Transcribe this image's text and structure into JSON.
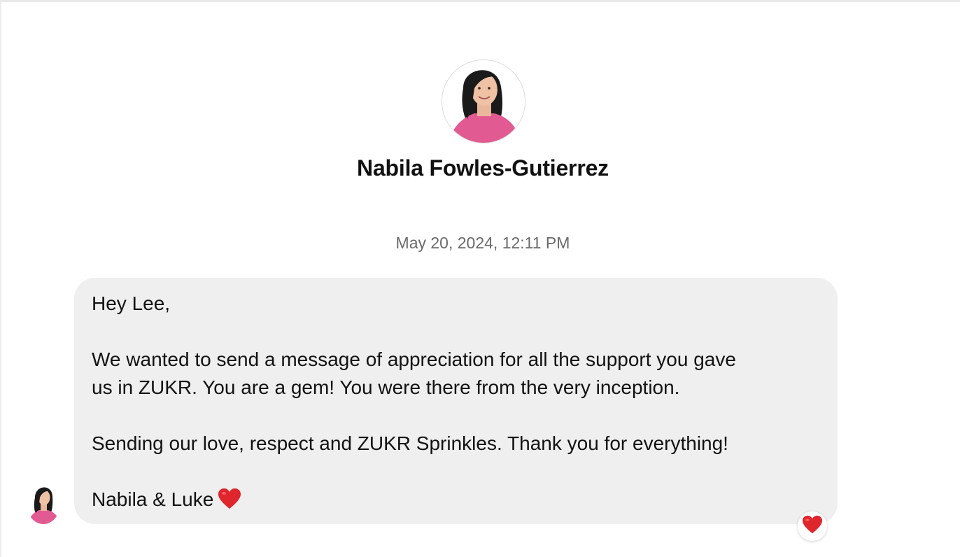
{
  "profile": {
    "name": "Nabila Fowles-Gutierrez",
    "avatar": "woman-dark-hair-pink-top-avatar"
  },
  "conversation": {
    "timestamp": "May 20, 2024, 12:11 PM",
    "message": {
      "lines": [
        "Hey Lee,",
        "",
        "We wanted to send a message of appreciation for all the support you gave",
        "us in ZUKR. You are a gem! You were there from the very inception.",
        "",
        "Sending our love, respect and ZUKR Sprinkles. Thank you for everything!",
        "",
        "Nabila & Luke"
      ],
      "signature_emoji": "red-heart-icon",
      "reaction": "red-heart-icon"
    }
  },
  "colors": {
    "bubble": "#efefef",
    "heart": "#e0262d",
    "shirt": "#e25a92",
    "hair": "#1a1a1a"
  }
}
